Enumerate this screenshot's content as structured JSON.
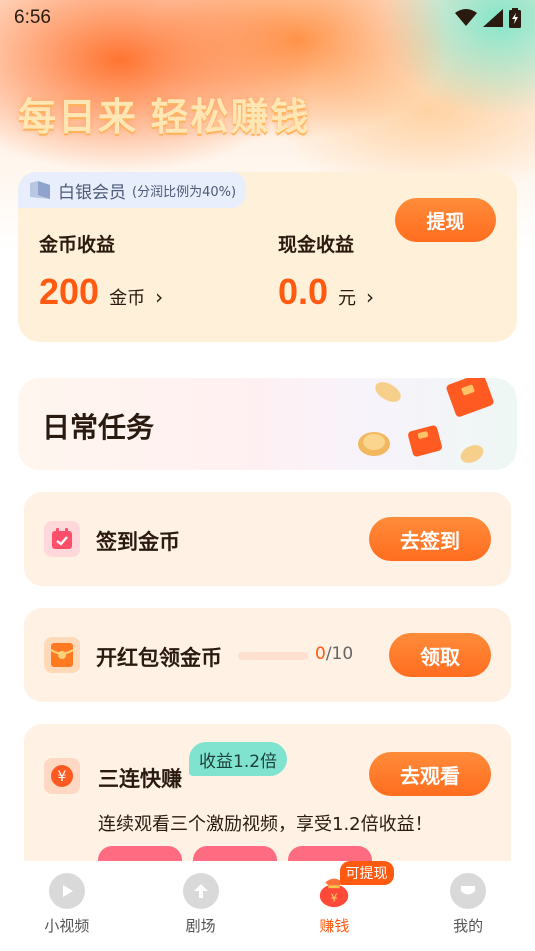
{
  "status_bar": {
    "time": "6:56",
    "icons": [
      "wifi-icon",
      "signal-icon",
      "battery-icon"
    ]
  },
  "headline": "每日来 轻松赚钱",
  "earnings": {
    "member_name": "白银会员",
    "member_ratio": "(分润比例为40%)",
    "withdraw_label": "提现",
    "coin": {
      "label": "金币收益",
      "value": "200",
      "unit": "金币"
    },
    "cash": {
      "label": "现金收益",
      "value": "0.0",
      "unit": "元"
    }
  },
  "daily": {
    "title": "日常任务"
  },
  "tasks": [
    {
      "title": "签到金币",
      "button": "去签到",
      "icon": "calendar-icon"
    },
    {
      "title": "开红包领金币",
      "button": "领取",
      "icon": "red-envelope-icon",
      "progress_current": "0",
      "progress_total": "/10",
      "progress_fraction": 0
    },
    {
      "title": "三连快赚",
      "button": "去观看",
      "icon": "yuan-coin-icon",
      "bonus_badge": "收益1.2倍",
      "description": "连续观看三个激励视频，享受1.2倍收益！"
    }
  ],
  "nav": {
    "items": [
      {
        "label": "小视频",
        "icon": "play-icon"
      },
      {
        "label": "剧场",
        "icon": "upload-arrow-icon"
      },
      {
        "label": "赚钱",
        "icon": "money-bag-icon",
        "badge": "可提现"
      },
      {
        "label": "我的",
        "icon": "profile-icon"
      }
    ],
    "active": "赚钱"
  },
  "colors": {
    "accent": "#ff6d1f",
    "card_bg": "#fff0d9",
    "task_bg": "#fff1e4",
    "bonus_badge": "#7fe3cf"
  }
}
